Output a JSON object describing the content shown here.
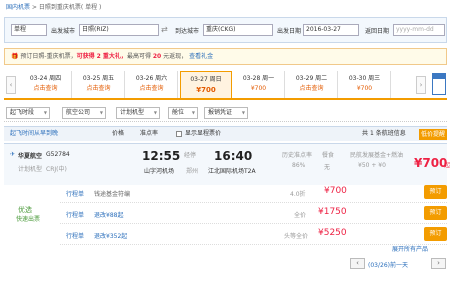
{
  "breadcrumb": {
    "root": "国内机票",
    "sep": " > ",
    "route": "日照到重庆机票",
    "type": "( 单程 )"
  },
  "search": {
    "trip_type": "单程",
    "from_label": "出发城市",
    "from_value": "日照(RIZ)",
    "to_label": "到达城市",
    "to_value": "重庆(CKG)",
    "depart_label": "出发日期",
    "depart_value": "2016-03-27",
    "return_label": "返回日期",
    "return_placeholder": "yyyy-mm-dd"
  },
  "promo": {
    "text1": "预订日照-重庆机票，",
    "highlight": "可获得 2 重大礼，",
    "text2": "最高可得 ",
    "highlight2": "20",
    "text3": " 元返现，",
    "link": "查看礼金"
  },
  "dates": [
    {
      "date": "03-24 周四",
      "price": "点击查询"
    },
    {
      "date": "03-25 周五",
      "price": "点击查询"
    },
    {
      "date": "03-26 周六",
      "price": "点击查询"
    },
    {
      "date": "03-27 周日",
      "price": "¥700",
      "active": true
    },
    {
      "date": "03-28 周一",
      "price": "¥700"
    },
    {
      "date": "03-29 周二",
      "price": "点击查询"
    },
    {
      "date": "03-30 周三",
      "price": "¥700"
    }
  ],
  "filters": [
    "起飞时段",
    "航空公司",
    "计划机型",
    "舱位",
    "报销凭证"
  ],
  "sort": {
    "dep_time": "起飞时间从早到晚",
    "price_label": "价格",
    "ontime": "准点率",
    "show_share": "显示显程票价",
    "count_prefix": "共",
    "count_num": "1",
    "count_suffix": "条航班信息",
    "lowprice": "低价提醒"
  },
  "flight": {
    "airline": "华夏航空",
    "flight_no": "G52784",
    "plan": "计划机型",
    "plan_detail": "CRJ(中)",
    "dep_time": "12:55",
    "dep_airport": "山字河机场",
    "stop_label": "经停",
    "stop_city": "郑州",
    "arr_time": "16:40",
    "arr_airport": "江北国际机场T2A",
    "ontime_label": "历史准点率",
    "ontime_value": "86%",
    "meal_label": "餐食",
    "meal_value": "无",
    "tax_label": "民航发展基金+燃油",
    "tax_value": "¥50 + ¥0",
    "price": "¥700",
    "price_suffix": "起"
  },
  "fares": [
    {
      "tag": "行程单",
      "desc": "钱途基金符编",
      "discount": "4.0折",
      "price": "¥700",
      "book": "预订"
    },
    {
      "tag": "行程单",
      "desc": "退改¥88起",
      "discount": "全价",
      "price": "¥1750",
      "book": "预订"
    },
    {
      "tag": "行程单",
      "desc": "退改¥352起",
      "discount": "头等全价",
      "price": "¥5250",
      "book": "预订"
    }
  ],
  "fare_group": {
    "label": "优选",
    "sub": "快速出票"
  },
  "expand_link": "展开所有产品",
  "pager": {
    "next_day": "(03/26)前一天",
    "prev": "‹",
    "next": "›"
  },
  "colors": {
    "accent": "#f39c00",
    "price": "#e24",
    "link": "#2a6ebb"
  }
}
